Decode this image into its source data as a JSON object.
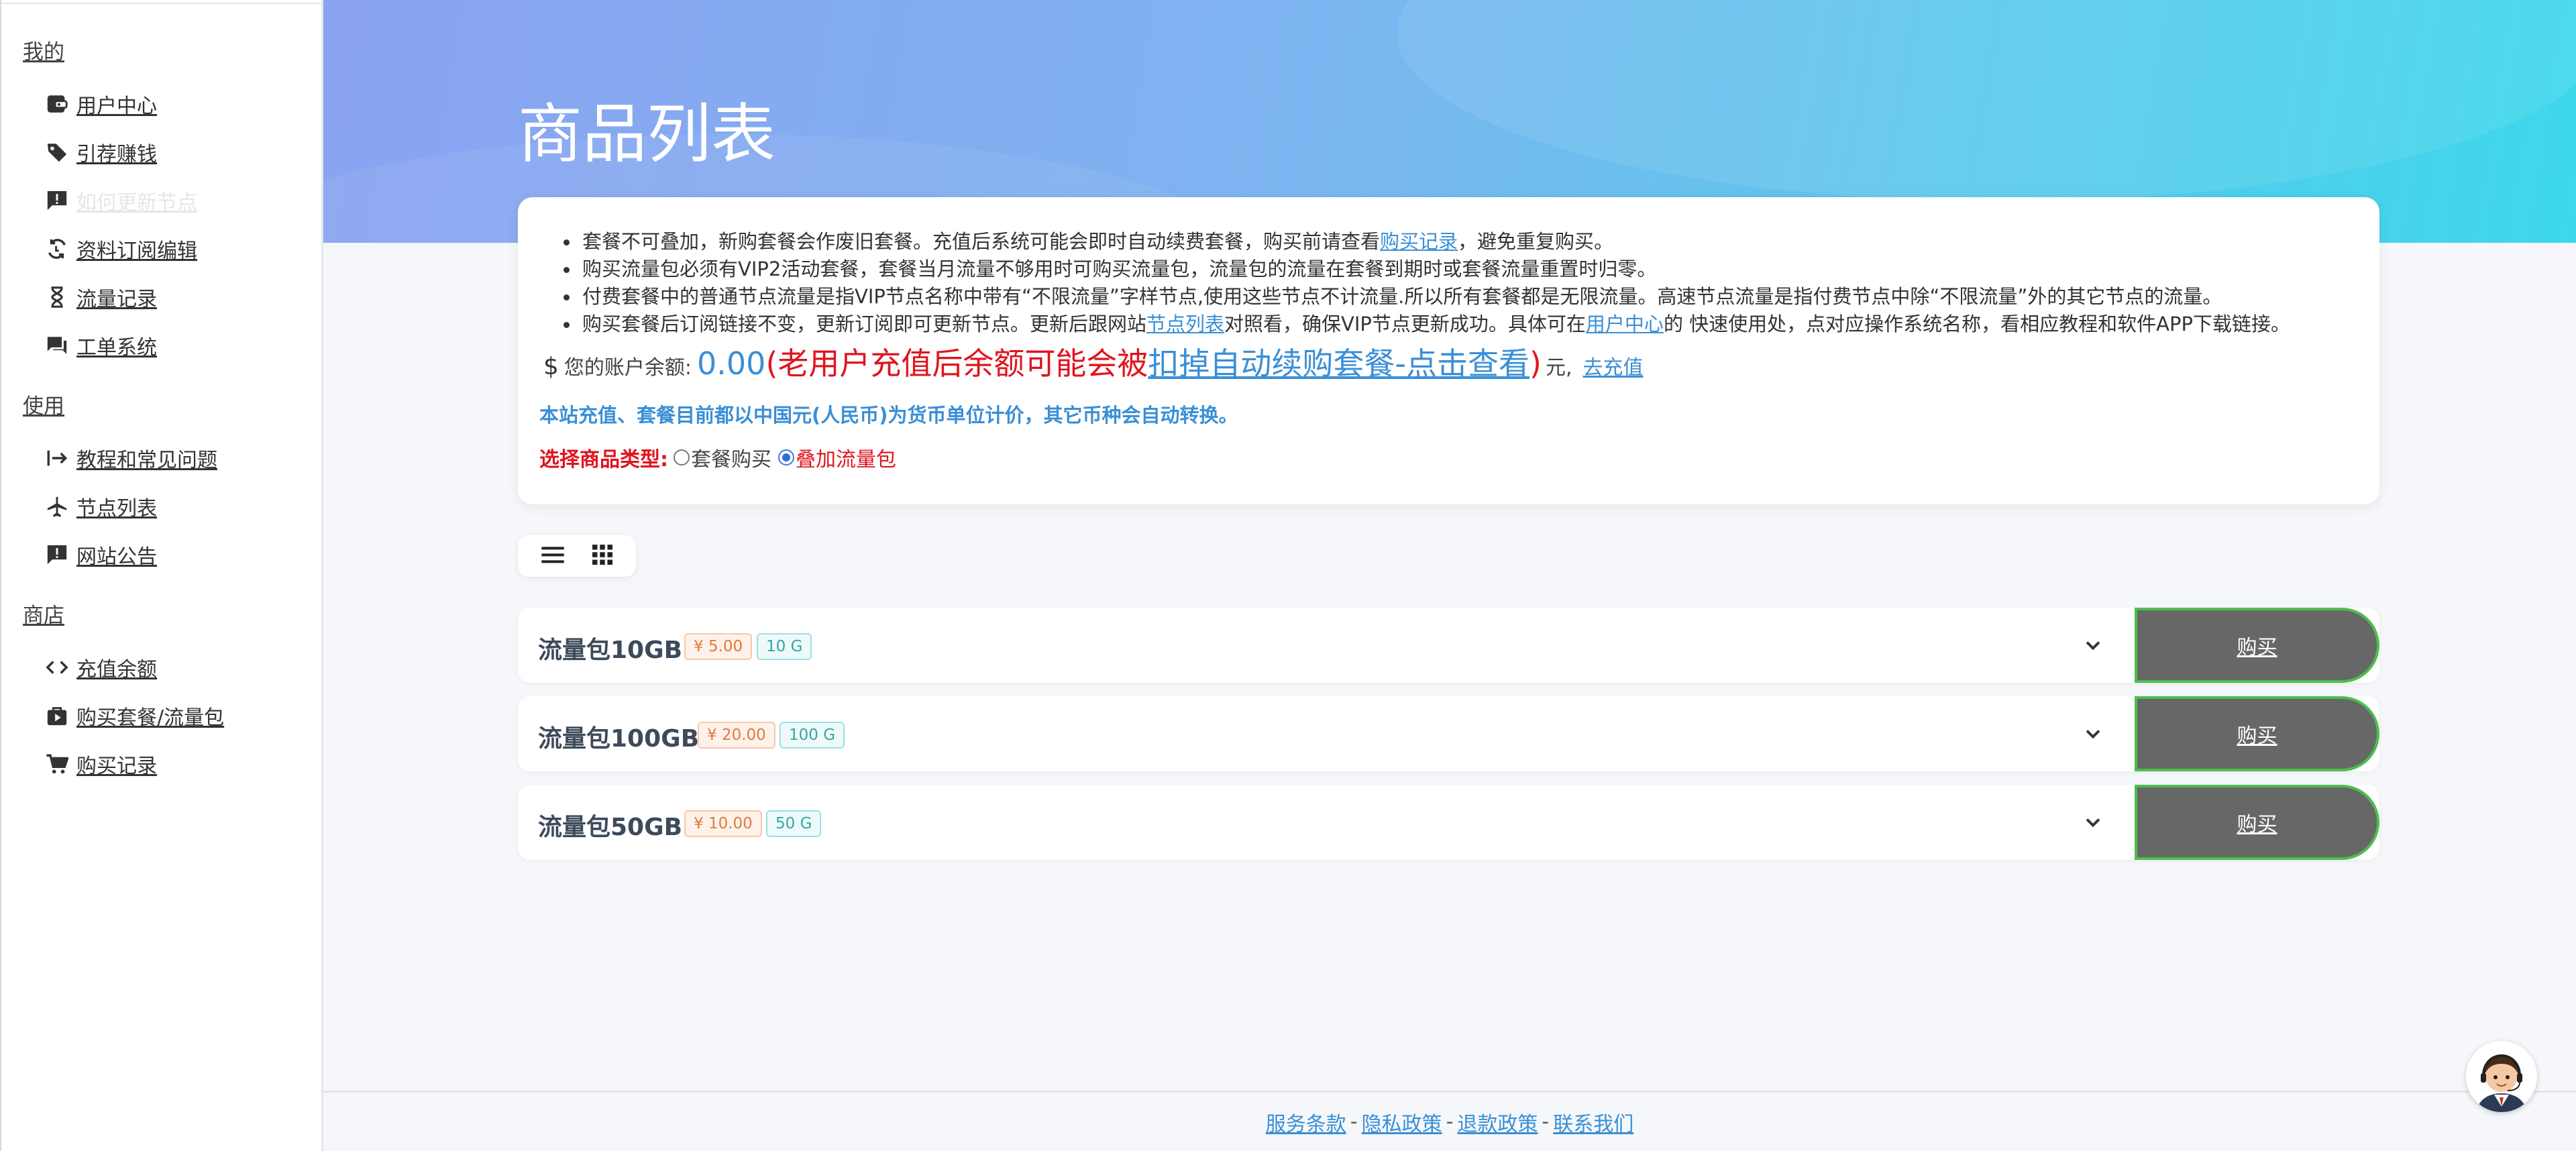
{
  "sidebar": {
    "sections": [
      {
        "title": "我的",
        "items": [
          {
            "label": "用户中心",
            "icon": "wallet-icon"
          },
          {
            "label": "引荐赚钱",
            "icon": "tags-icon"
          },
          {
            "label": "如何更新节点",
            "icon": "alert-message-icon",
            "faded": true
          },
          {
            "label": "资料订阅编辑",
            "icon": "sync-icon"
          },
          {
            "label": "流量记录",
            "icon": "hourglass-icon"
          },
          {
            "label": "工单系统",
            "icon": "chat-icon"
          }
        ]
      },
      {
        "title": "使用",
        "items": [
          {
            "label": "教程和常见问题",
            "icon": "sign-in-icon"
          },
          {
            "label": "节点列表",
            "icon": "plane-icon"
          },
          {
            "label": "网站公告",
            "icon": "announcement-icon"
          }
        ]
      },
      {
        "title": "商店",
        "items": [
          {
            "label": "充值余额",
            "icon": "code-icon"
          },
          {
            "label": "购买套餐/流量包",
            "icon": "shopping-bag-icon"
          },
          {
            "label": "购买记录",
            "icon": "cart-icon"
          }
        ]
      }
    ]
  },
  "header": {
    "title": "商品列表"
  },
  "notice": {
    "line1_a": "套餐不可叠加，新购套餐会作废旧套餐。充值后系统可能会即时自动续费套餐，购买前请查看",
    "line1_link": "购买记录",
    "line1_b": "，避免重复购买。",
    "line2": "购买流量包必须有VIP2活动套餐，套餐当月流量不够用时可购买流量包，流量包的流量在套餐到期时或套餐流量重置时归零。",
    "line3": "付费套餐中的普通节点流量是指VIP节点名称中带有“不限流量”字样节点,使用这些节点不计流量.所以所有套餐都是无限流量。高速节点流量是指付费节点中除“不限流量”外的其它节点的流量。",
    "line4_a": "购买套餐后订阅链接不变，更新订阅即可更新节点。更新后跟网站",
    "line4_link1": "节点列表",
    "line4_b": "对照看，确保VIP节点更新成功。具体可在",
    "line4_link2": "用户中心",
    "line4_c": "的 快速使用处，点对应操作系统名称，看相应教程和软件APP下载链接。"
  },
  "balance": {
    "symbol": "$",
    "label": "您的账户余额:",
    "amount": "0.00",
    "warn_a": "(老用户充值后余额可能会被",
    "warn_link": "扣掉自动续购套餐-点击查看",
    "warn_b": ")",
    "unit": "元,",
    "recharge": "去充值"
  },
  "currency_note": "本站充值、套餐目前都以中国元(人民币)为货币单位计价，其它币种会自动转换。",
  "type_select": {
    "label": "选择商品类型:",
    "options": [
      "套餐购买",
      "叠加流量包"
    ],
    "selected": "叠加流量包"
  },
  "products": [
    {
      "name": "流量包10GB",
      "price": "¥ 5.00",
      "size": "10 G",
      "buy": "购买"
    },
    {
      "name": "流量包100GB",
      "price": "¥ 20.00",
      "size": "100 G",
      "buy": "购买"
    },
    {
      "name": "流量包50GB",
      "price": "¥ 10.00",
      "size": "50 G",
      "buy": "购买"
    }
  ],
  "footer": {
    "links": [
      "服务条款",
      "隐私政策",
      "退款政策",
      "联系我们"
    ],
    "sep": "-"
  },
  "colors": {
    "accent_blue": "#3a8fd6",
    "warn_red": "#e0141e",
    "buy_button": "#676767",
    "buy_border": "#4bbf4b"
  }
}
